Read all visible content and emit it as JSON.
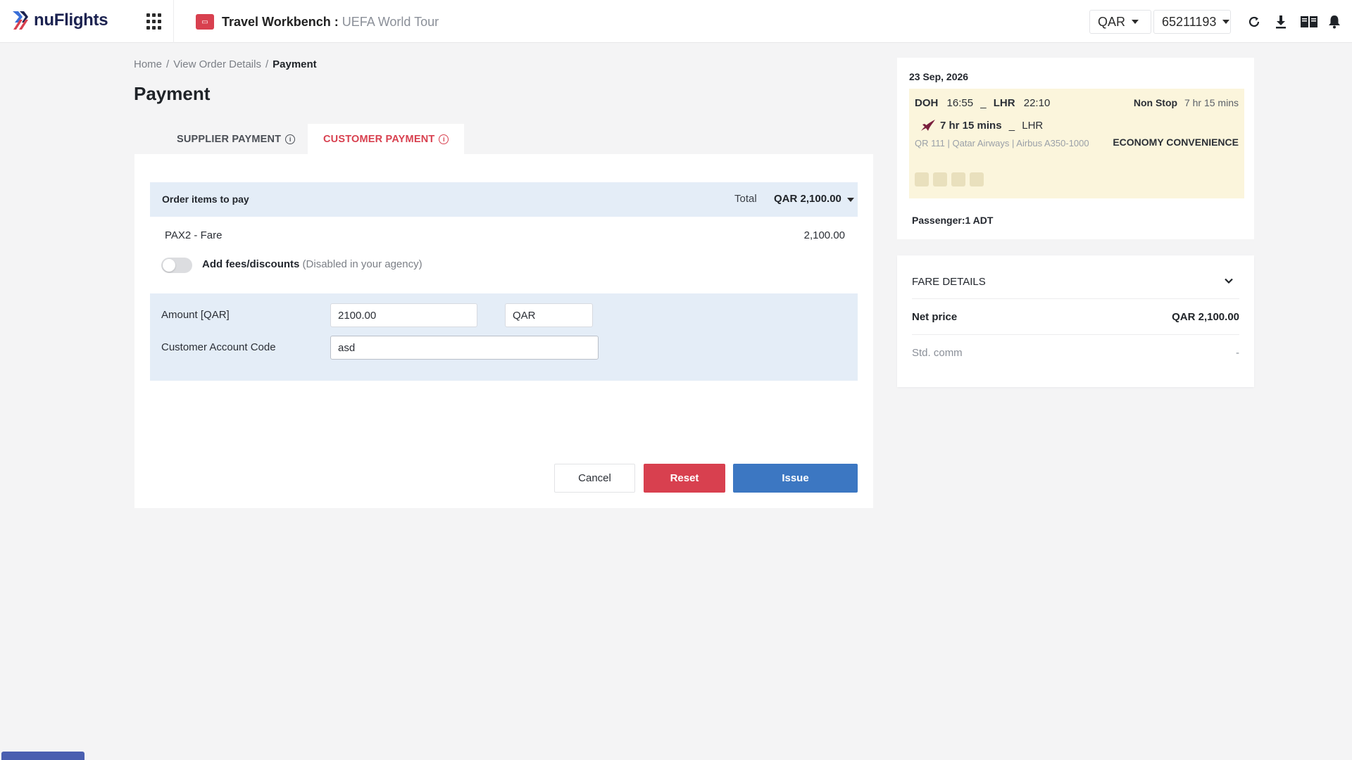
{
  "header": {
    "logo_text": "nuFlights",
    "workbench_label": "Travel Workbench :",
    "workbench_name": "UEFA World Tour",
    "currency": "QAR",
    "account_id": "65211193",
    "icons": [
      "apps-grid-icon",
      "refresh-icon",
      "download-icon",
      "book-icon",
      "bell-icon"
    ],
    "accent_color": "#d8404f"
  },
  "breadcrumb": {
    "items": [
      "Home",
      "View Order Details",
      "Payment"
    ],
    "separator": "/"
  },
  "page_title": "Payment",
  "tabs": [
    {
      "label": "SUPPLIER PAYMENT",
      "active": false
    },
    {
      "label": "CUSTOMER PAYMENT",
      "active": true
    }
  ],
  "order": {
    "header_label": "Order items to pay",
    "total_label": "Total",
    "total_value": "QAR 2,100.00",
    "pax_label": "PAX2",
    "fare_label": "- Fare",
    "fare_amount": "2,100.00",
    "fees_label": "Add fees/discounts",
    "fees_note": "(Disabled in your agency)",
    "fees_enabled": false
  },
  "form": {
    "amount_label": "Amount [QAR]",
    "amount_value": "2100.00",
    "currency_value": "QAR",
    "account_code_label": "Customer Account Code",
    "account_code_value": "asd"
  },
  "buttons": {
    "cancel": "Cancel",
    "reset": "Reset",
    "issue": "Issue"
  },
  "flight": {
    "date": "23 Sep, 2026",
    "origin": "DOH",
    "depart_time": "16:55",
    "dash": "_",
    "destination": "LHR",
    "arrive_time": "22:10",
    "stops": "Non Stop",
    "duration": "7 hr 15 mins",
    "leg_duration": "7 hr 15 mins",
    "leg_dest": "LHR",
    "flight_info": "QR 111 | Qatar Airways | Airbus A350-1000",
    "cabin": "ECONOMY CONVENIENCE",
    "passenger": "Passenger:1 ADT",
    "amenity_icons": [
      "wifi-icon",
      "power-icon",
      "meal-icon",
      "entertainment-icon"
    ]
  },
  "fare_details": {
    "title": "FARE DETAILS",
    "net_price_label": "Net price",
    "net_price_value": "QAR 2,100.00",
    "std_comm_label": "Std. comm",
    "std_comm_value": "-"
  }
}
